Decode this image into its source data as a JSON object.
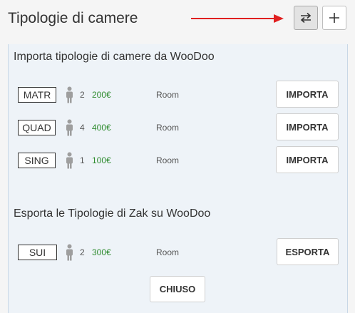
{
  "header": {
    "title": "Tipologie di camere",
    "sync_icon": "swap-arrows-icon",
    "add_icon": "plus-icon",
    "annotation_color": "#e02020"
  },
  "import_section": {
    "title": "Importa tipologie di camere da WooDoo",
    "rooms": [
      {
        "code": "MATR",
        "guests": "2",
        "price": "200€",
        "type": "Room",
        "action": "IMPORTA"
      },
      {
        "code": "QUAD",
        "guests": "4",
        "price": "400€",
        "type": "Room",
        "action": "IMPORTA"
      },
      {
        "code": "SING",
        "guests": "1",
        "price": "100€",
        "type": "Room",
        "action": "IMPORTA"
      }
    ]
  },
  "export_section": {
    "title": "Esporta le Tipologie di Zak su WooDoo",
    "rooms": [
      {
        "code": "SUI",
        "guests": "2",
        "price": "300€",
        "type": "Room",
        "action": "ESPORTA"
      }
    ]
  },
  "footer": {
    "close_label": "CHIUSO"
  },
  "colors": {
    "price": "#2e8b2e",
    "panel_bg": "#eef3f8"
  }
}
